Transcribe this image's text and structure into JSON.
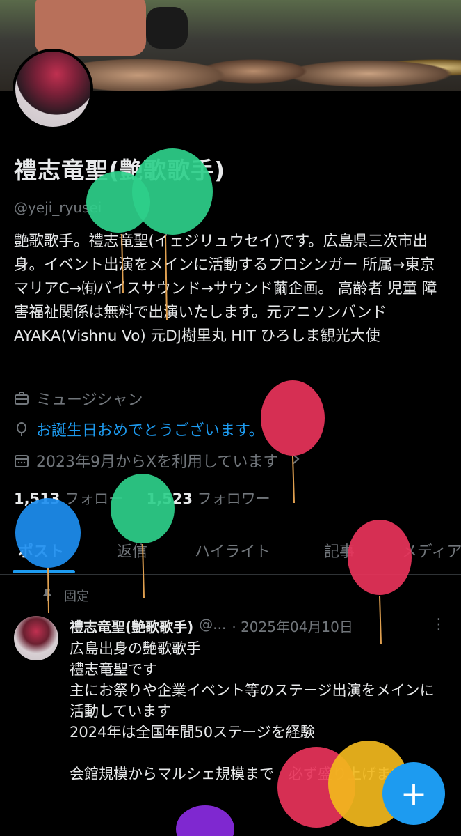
{
  "profile": {
    "name": "禮志竜聖(艶歌歌手)",
    "handle": "@yeji_ryusei",
    "bio": "艶歌歌手。禮志竜聖(イェジリュウセイ)です。広島県三次市出身。イベント出演をメインに活動するプロシンガー 所属→東京マリアC→㈲バイスサウンド→サウンド繭企画。 高齢者 児童 障害福祉関係は無料で出演いたします。元アニソンバンドAYAKA(Vishnu Vo) 元DJ樹里丸 HIT ひろしま観光大使",
    "profession": "ミュージシャン",
    "birthday": "お誕生日おめでとうございます。",
    "joined": "2023年9月からXを利用しています",
    "following_count": "1,513",
    "following_label": "フォロー",
    "followers_count": "1,523",
    "followers_label": "フォロワー"
  },
  "icons": {
    "profession": "briefcase-icon",
    "birthday": "balloon-icon",
    "joined": "calendar-icon",
    "joined_arrow": "chevron-right-icon",
    "pinned": "pin-icon",
    "more": "more-icon",
    "fab": "plus-icon"
  },
  "tabs": [
    {
      "label": "ポスト"
    },
    {
      "label": "返信"
    },
    {
      "label": "ハイライト"
    },
    {
      "label": "記事"
    },
    {
      "label": "メディア"
    }
  ],
  "pinned_post": {
    "pinned_label": "固定",
    "author": "禮志竜聖(艶歌歌手)",
    "handle_short": "@...",
    "date": "· 2025年04月10日",
    "more": "⋮",
    "body": "広島出身の艶歌歌手\n禮志竜聖です\n主にお祭りや企業イベント等のステージ出演をメインに活動しています\n2024年は全国年間50ステージを経験\n\n会館規模からマルシェ規模まで　必ず盛り上げます！"
  },
  "fab": {
    "label": "+"
  },
  "colors": {
    "accent": "#1d9bf0",
    "background": "#000000",
    "text": "#e7e9ea",
    "muted": "#71767b",
    "balloon_green": "#2ecf8a",
    "balloon_red": "#e8335a",
    "balloon_blue": "#1d8ef0",
    "balloon_yellow": "#f2b81d",
    "balloon_purple": "#8a2be2"
  }
}
